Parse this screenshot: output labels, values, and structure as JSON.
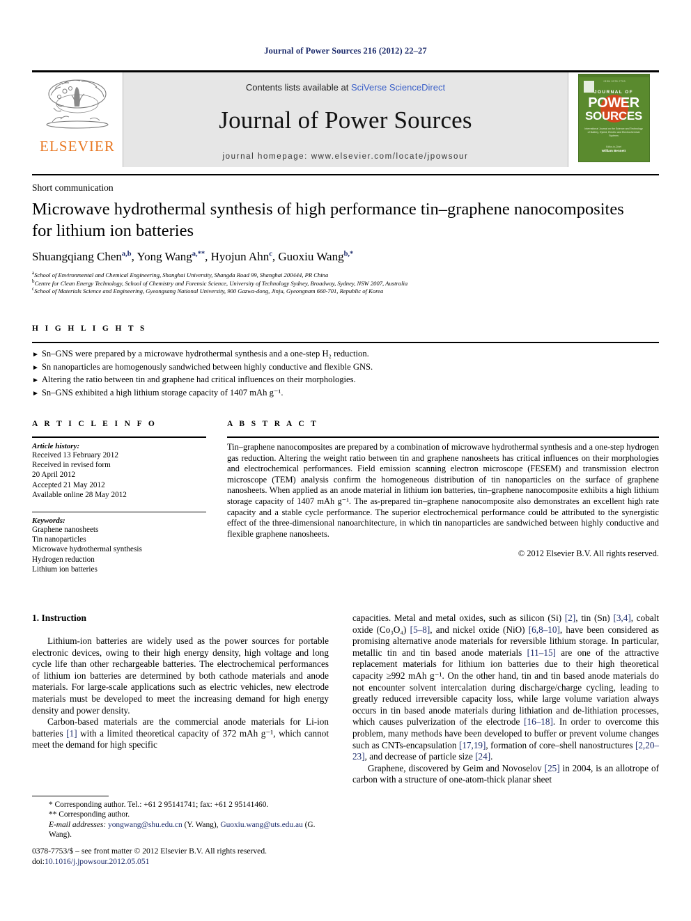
{
  "running_head": "Journal of Power Sources 216 (2012) 22–27",
  "masthead": {
    "publisher_name": "ELSEVIER",
    "contents_prefix": "Contents lists available at ",
    "contents_link": "SciVerse ScienceDirect",
    "journal_name": "Journal of Power Sources",
    "homepage": "journal homepage: www.elsevier.com/locate/jpowsour",
    "cover": {
      "line_top": "JOURNAL OF",
      "word1": "POWER",
      "word2": "SOURCES",
      "subtitle": "International Journal on the Science and Technology of Battery, Hybrid, Electric and Electrochemical Systems",
      "footer_small": "Editor-in-Chief",
      "footer_name": "William Bennett"
    }
  },
  "article": {
    "type": "Short communication",
    "title": "Microwave hydrothermal synthesis of high performance tin–graphene nanocomposites for lithium ion batteries",
    "authors": [
      {
        "name": "Shuangqiang Chen",
        "sup": "a,b"
      },
      {
        "name": "Yong Wang",
        "sup": "a,**"
      },
      {
        "name": "Hyojun Ahn",
        "sup": "c"
      },
      {
        "name": "Guoxiu Wang",
        "sup": "b,*"
      }
    ],
    "affiliations": [
      {
        "mark": "a",
        "text": "School of Environmental and Chemical Engineering, Shanghai University, Shangda Road 99, Shanghai 200444, PR China"
      },
      {
        "mark": "b",
        "text": "Centre for Clean Energy Technology, School of Chemistry and Forensic Science, University of Technology Sydney, Broadway, Sydney, NSW 2007, Australia"
      },
      {
        "mark": "c",
        "text": "School of Materials Science and Engineering, Gyeongsang National University, 900 Gazwa-dong, Jinju, Gyeongnam 660-701, Republic of Korea"
      }
    ]
  },
  "highlights": {
    "label": "H I G H L I G H T S",
    "items": [
      "Sn–GNS were prepared by a microwave hydrothermal synthesis and a one-step H₂ reduction.",
      "Sn nanoparticles are homogenously sandwiched between highly conductive and flexible GNS.",
      "Altering the ratio between tin and graphene had critical influences on their morphologies.",
      "Sn–GNS exhibited a high lithium storage capacity of 1407 mAh g⁻¹."
    ]
  },
  "article_info": {
    "label": "A R T I C L E  I N F O",
    "history_head": "Article history:",
    "history": [
      "Received 13 February 2012",
      "Received in revised form",
      "20 April 2012",
      "Accepted 21 May 2012",
      "Available online 28 May 2012"
    ],
    "keywords_head": "Keywords:",
    "keywords": [
      "Graphene nanosheets",
      "Tin nanoparticles",
      "Microwave hydrothermal synthesis",
      "Hydrogen reduction",
      "Lithium ion batteries"
    ]
  },
  "abstract": {
    "label": "A B S T R A C T",
    "text": "Tin–graphene nanocomposites are prepared by a combination of microwave hydrothermal synthesis and a one-step hydrogen gas reduction. Altering the weight ratio between tin and graphene nanosheets has critical influences on their morphologies and electrochemical performances. Field emission scanning electron microscope (FESEM) and transmission electron microscope (TEM) analysis confirm the homogeneous distribution of tin nanoparticles on the surface of graphene nanosheets. When applied as an anode material in lithium ion batteries, tin–graphene nanocomposite exhibits a high lithium storage capacity of 1407 mAh g⁻¹. The as-prepared tin–graphene nanocomposite also demonstrates an excellent high rate capacity and a stable cycle performance. The superior electrochemical performance could be attributed to the synergistic effect of the three-dimensional nanoarchitecture, in which tin nanoparticles are sandwiched between highly conductive and flexible graphene nanosheets.",
    "copyright": "© 2012 Elsevier B.V. All rights reserved."
  },
  "body": {
    "section_title": "1. Instruction",
    "left_paragraphs": [
      "Lithium-ion batteries are widely used as the power sources for portable electronic devices, owing to their high energy density, high voltage and long cycle life than other rechargeable batteries. The electrochemical performances of lithium ion batteries are determined by both cathode materials and anode materials. For large-scale applications such as electric vehicles, new electrode materials must be developed to meet the increasing demand for high energy density and power density."
    ],
    "left_para2_a": "Carbon-based materials are the commercial anode materials for Li-ion batteries ",
    "left_para2_ref": "[1]",
    "left_para2_b": " with a limited theoretical capacity of 372 mAh g⁻¹, which cannot meet the demand for high specific",
    "right_para1_parts": [
      {
        "t": "capacities. Metal and metal oxides, such as silicon (Si) "
      },
      {
        "t": "[2]",
        "ref": true
      },
      {
        "t": ", tin (Sn) "
      },
      {
        "t": "[3,4]",
        "ref": true
      },
      {
        "t": ", cobalt oxide (Co₃O₄) "
      },
      {
        "t": "[5–8]",
        "ref": true
      },
      {
        "t": ", and nickel oxide (NiO) "
      },
      {
        "t": "[6,8–10]",
        "ref": true
      },
      {
        "t": ", have been considered as promising alternative anode materials for reversible lithium storage. In particular, metallic tin and tin based anode materials "
      },
      {
        "t": "[11–15]",
        "ref": true
      },
      {
        "t": " are one of the attractive replacement materials for lithium ion batteries due to their high theoretical capacity ≥992 mAh g⁻¹. On the other hand, tin and tin based anode materials do not encounter solvent intercalation during discharge/charge cycling, leading to greatly reduced irreversible capacity loss, while large volume variation always occurs in tin based anode materials during lithiation and de-lithiation processes, which causes pulverization of the electrode "
      },
      {
        "t": "[16–18]",
        "ref": true
      },
      {
        "t": ". In order to overcome this problem, many methods have been developed to buffer or prevent volume changes such as CNTs-encapsulation "
      },
      {
        "t": "[17,19]",
        "ref": true
      },
      {
        "t": ", formation of core–shell nanostructures "
      },
      {
        "t": "[2,20–23]",
        "ref": true
      },
      {
        "t": ", and decrease of particle size "
      },
      {
        "t": "[24]",
        "ref": true
      },
      {
        "t": "."
      }
    ],
    "right_para2_parts": [
      {
        "t": "Graphene, discovered by Geim and Novoselov "
      },
      {
        "t": "[25]",
        "ref": true
      },
      {
        "t": " in 2004, is an allotrope of carbon with a structure of one-atom-thick planar sheet"
      }
    ]
  },
  "footnotes": {
    "line1": "* Corresponding author. Tel.: +61 2 95141741; fax: +61 2 95141460.",
    "line2": "** Corresponding author.",
    "email_label": "E-mail addresses:",
    "email1": "yongwang@shu.edu.cn",
    "email1_name": "(Y. Wang),",
    "email2": "Guoxiu.wang@uts.edu.au",
    "email2_name": "(G. Wang)."
  },
  "imprint": {
    "line1": "0378-7753/$ – see front matter © 2012 Elsevier B.V. All rights reserved.",
    "doi_prefix": "doi:",
    "doi": "10.1016/j.jpowsour.2012.05.051"
  },
  "colors": {
    "link": "#1c2b6b",
    "elsevier_orange": "#E87722",
    "cover_green": "#5a8a2e",
    "masthead_gray": "#e6e6e6"
  }
}
